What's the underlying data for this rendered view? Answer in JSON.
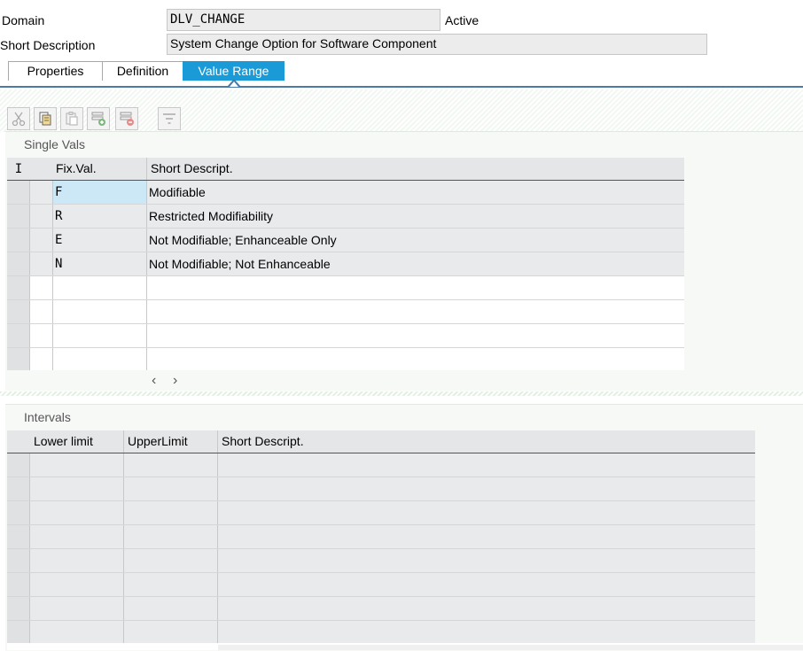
{
  "header": {
    "domain_label": "Domain",
    "domain_value": "DLV_CHANGE",
    "status": "Active",
    "short_desc_label": "Short Description",
    "short_desc_value": "System Change Option for Software Component"
  },
  "tabs": [
    {
      "label": "Properties"
    },
    {
      "label": "Definition"
    },
    {
      "label": "Value Range",
      "active": true
    }
  ],
  "toolbar": {
    "icons": [
      "cut-icon",
      "copy-icon",
      "paste-icon",
      "insert-row-icon",
      "delete-row-icon",
      "filter-icon"
    ]
  },
  "single_vals": {
    "title": "Single Vals",
    "columns": [
      "I",
      "Fix.Val.",
      "Short Descript."
    ],
    "rows": [
      {
        "fix_val": "F",
        "desc": "Modifiable"
      },
      {
        "fix_val": "R",
        "desc": "Restricted Modifiability"
      },
      {
        "fix_val": "E",
        "desc": "Not Modifiable; Enhanceable Only"
      },
      {
        "fix_val": "N",
        "desc": "Not Modifiable; Not Enhanceable"
      }
    ],
    "scroll_left": "‹",
    "scroll_right": "›"
  },
  "intervals": {
    "title": "Intervals",
    "columns": [
      "Lower limit",
      "UpperLimit",
      "Short Descript."
    ]
  },
  "colors": {
    "accent": "#1a9ad6",
    "tab_line": "#4a7aa8",
    "selected_cell": "#cce8f6"
  }
}
